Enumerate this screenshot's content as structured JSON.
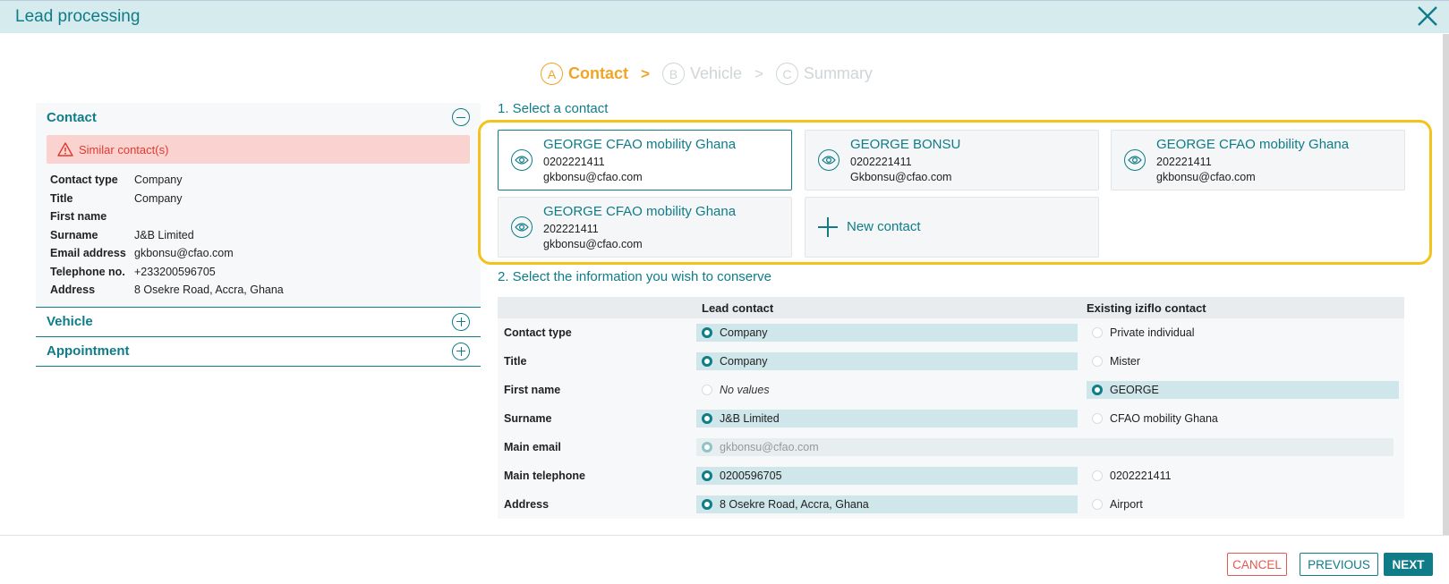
{
  "window": {
    "title": "Lead processing"
  },
  "stepper": [
    {
      "letter": "A",
      "label": "Contact",
      "active": true
    },
    {
      "letter": "B",
      "label": "Vehicle",
      "active": false
    },
    {
      "letter": "C",
      "label": "Summary",
      "active": false
    }
  ],
  "stepper_separator": ">",
  "left": {
    "contact_section": "Contact",
    "alert": "Similar contact(s)",
    "fields": [
      {
        "key": "Contact type",
        "value": "Company"
      },
      {
        "key": "Title",
        "value": "Company"
      },
      {
        "key": "First name",
        "value": ""
      },
      {
        "key": "Surname",
        "value": "J&B Limited"
      },
      {
        "key": "Email address",
        "value": "gkbonsu@cfao.com"
      },
      {
        "key": "Telephone no.",
        "value": "+233200596705"
      },
      {
        "key": "Address",
        "value": "8 Osekre Road, Accra, Ghana"
      }
    ],
    "vehicle_section": "Vehicle",
    "appointment_section": "Appointment"
  },
  "select_contact": {
    "title": "1. Select a contact",
    "cards": [
      {
        "name": "GEORGE CFAO mobility Ghana",
        "phone": "0202221411",
        "email": "gkbonsu@cfao.com",
        "selected": true
      },
      {
        "name": "GEORGE BONSU",
        "phone": "0202221411",
        "email": "Gkbonsu@cfao.com",
        "selected": false
      },
      {
        "name": "GEORGE CFAO mobility Ghana",
        "phone": "202221411",
        "email": "gkbonsu@cfao.com",
        "selected": false
      },
      {
        "name": "GEORGE CFAO mobility Ghana",
        "phone": "202221411",
        "email": "gkbonsu@cfao.com",
        "selected": false
      }
    ],
    "new_contact": "New contact"
  },
  "conserve": {
    "title": "2. Select the information you wish to conserve",
    "col_lead": "Lead contact",
    "col_existing": "Existing iziflo contact",
    "rows": [
      {
        "label": "Contact type",
        "lead": "Company",
        "existing": "Private individual",
        "pick": "lead"
      },
      {
        "label": "Title",
        "lead": "Company",
        "existing": "Mister",
        "pick": "lead"
      },
      {
        "label": "First name",
        "lead": "No values",
        "existing": "GEORGE",
        "pick": "existing"
      },
      {
        "label": "Surname",
        "lead": "J&B Limited",
        "existing": "CFAO mobility Ghana",
        "pick": "lead"
      },
      {
        "label": "Main email",
        "lead": "gkbonsu@cfao.com",
        "existing": "",
        "pick": "same"
      },
      {
        "label": "Main telephone",
        "lead": "0200596705",
        "existing": "0202221411",
        "pick": "lead"
      },
      {
        "label": "Address",
        "lead": "8 Osekre Road, Accra, Ghana",
        "existing": "Airport",
        "pick": "lead"
      }
    ]
  },
  "footer": {
    "cancel": "CANCEL",
    "previous": "PREVIOUS",
    "next": "NEXT"
  },
  "colors": {
    "primary": "#0f7c88",
    "accent": "#f0a526",
    "danger": "#e03a2f",
    "highlight": "#f3c21b"
  }
}
